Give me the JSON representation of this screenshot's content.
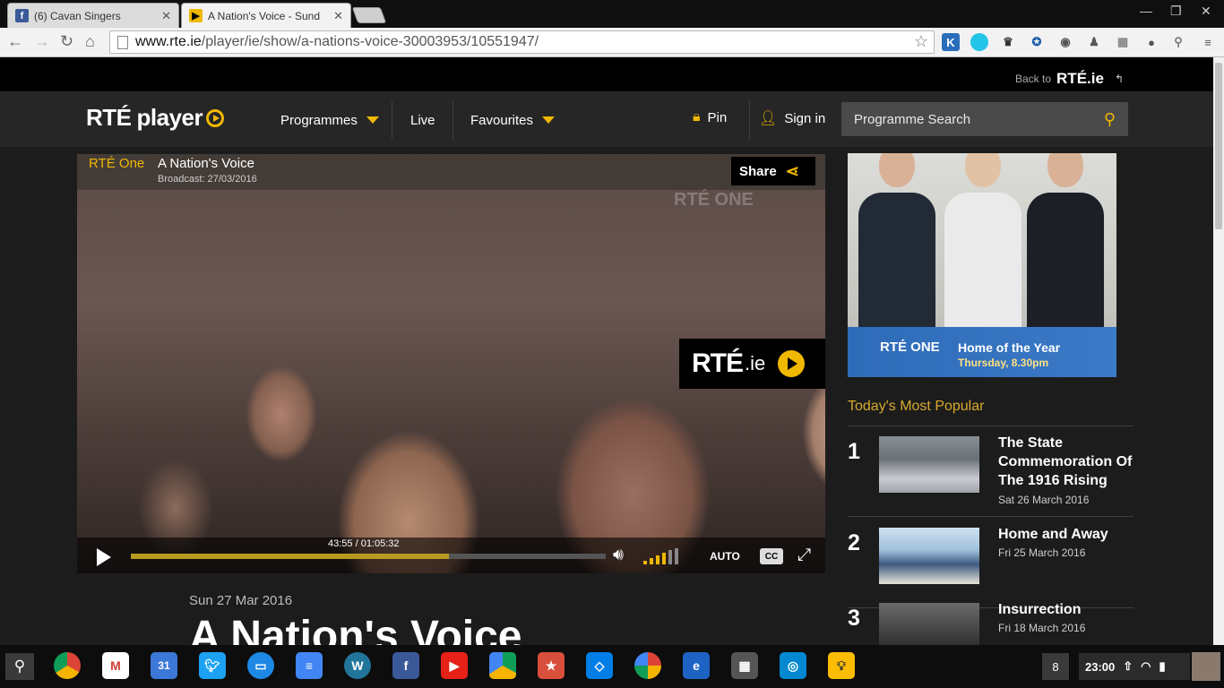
{
  "browser": {
    "tabs": [
      {
        "title": "(6) Cavan Singers",
        "favicon": "facebook-icon",
        "active": false
      },
      {
        "title": "A Nation's Voice - Sund",
        "favicon": "rte-player-icon",
        "active": true
      }
    ],
    "url_host": "www.rte.ie",
    "url_path": "/player/ie/show/a-nations-voice-30003953/10551947/"
  },
  "topbar": {
    "back_label": "Back to",
    "back_brand": "RTÉ.ie"
  },
  "header": {
    "logo_rte": "RTÉ",
    "logo_player": "player",
    "nav": [
      {
        "label": "Programmes",
        "dropdown": true
      },
      {
        "label": "Live",
        "dropdown": false
      },
      {
        "label": "Favourites",
        "dropdown": true
      }
    ],
    "pin_label": "Pin",
    "signin_label": "Sign in",
    "search_placeholder": "Programme Search"
  },
  "player": {
    "channel": "RTÉ One",
    "title": "A Nation's Voice",
    "broadcast": "Broadcast: 27/03/2016",
    "share_label": "Share",
    "watermark": "RTÉ ONE",
    "badge_rte": "RTÉ",
    "badge_ie": ".ie",
    "time": "43:55 / 01:05:32",
    "progress_fraction": 0.67,
    "quality": "AUTO",
    "cc_label": "CC"
  },
  "programme": {
    "date": "Sun 27 Mar 2016",
    "title": "A Nation's Voice"
  },
  "promo": {
    "channel": "RTÉ ONE",
    "title": "Home of the Year",
    "time": "Thursday, 8.30pm"
  },
  "popular": {
    "heading": "Today's Most Popular",
    "items": [
      {
        "rank": "1",
        "title": "The State Commemoration Of The 1916 Rising",
        "date": "Sat 26 March 2016"
      },
      {
        "rank": "2",
        "title": "Home and Away",
        "date": "Fri 25 March 2016"
      },
      {
        "rank": "3",
        "title": "Insurrection",
        "date": "Fri 18 March 2016"
      }
    ]
  },
  "taskbar": {
    "notification_count": "8",
    "clock": "23:00",
    "apps": [
      "chrome-icon",
      "gmail-icon",
      "calendar-icon",
      "twitter-icon",
      "files-icon",
      "docs-icon",
      "wordpress-icon",
      "facebook-icon",
      "youtube-icon",
      "drive-icon",
      "bookmark-icon",
      "dropbox-icon",
      "picasa-icon",
      "ie-icon",
      "calculator-icon",
      "camera-icon",
      "keep-icon"
    ],
    "calendar_day": "31"
  },
  "colors": {
    "accent": "#f0b800",
    "page_bg": "#1c1c1c",
    "header_bg": "#262626",
    "popular_heading": "#d8aa2c"
  }
}
